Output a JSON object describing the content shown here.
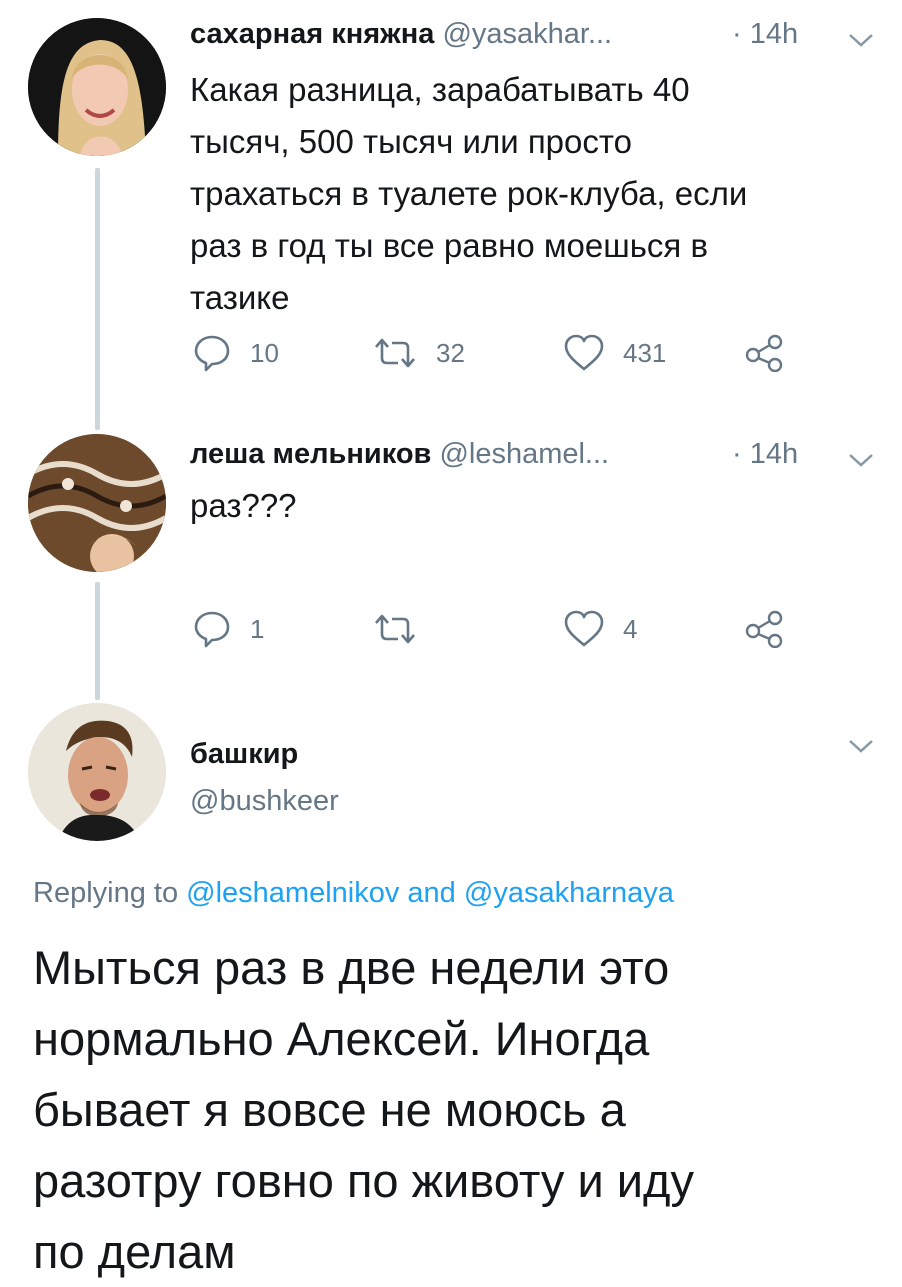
{
  "tweets": [
    {
      "name": "сахарная княжна",
      "handle": "@yasakhar...",
      "time": "· 14h",
      "text_lines": [
        "Какая разница, зарабатывать 40",
        "тысяч, 500 тысяч или просто",
        "трахаться в туалете рок-клуба, если",
        "раз в год ты все равно моешься в",
        "тазике"
      ],
      "replies": "10",
      "retweets": "32",
      "likes": "431"
    },
    {
      "name": "леша мельников",
      "handle": "@leshamel...",
      "time": "· 14h",
      "text_lines": [
        "раз???"
      ],
      "replies": "1",
      "retweets": "",
      "likes": "4"
    }
  ],
  "main": {
    "name": "башкир",
    "handle": "@bushkeer",
    "replying_prefix": "Replying to",
    "replying_user1": "@leshamelnikov",
    "replying_and": "and",
    "replying_user2": "@yasakharnaya",
    "text_lines": [
      "Мыться раз в две недели это",
      "нормально Алексей. Иногда",
      "бывает я вовсе не моюсь а",
      "разотру говно по животу и иду",
      "по делам"
    ]
  },
  "colors": {
    "link": "#1da1f2",
    "muted": "#657786",
    "line": "#ccd6dd"
  },
  "icons": [
    "reply-icon",
    "retweet-icon",
    "like-icon",
    "share-icon",
    "chevron-down-icon"
  ]
}
